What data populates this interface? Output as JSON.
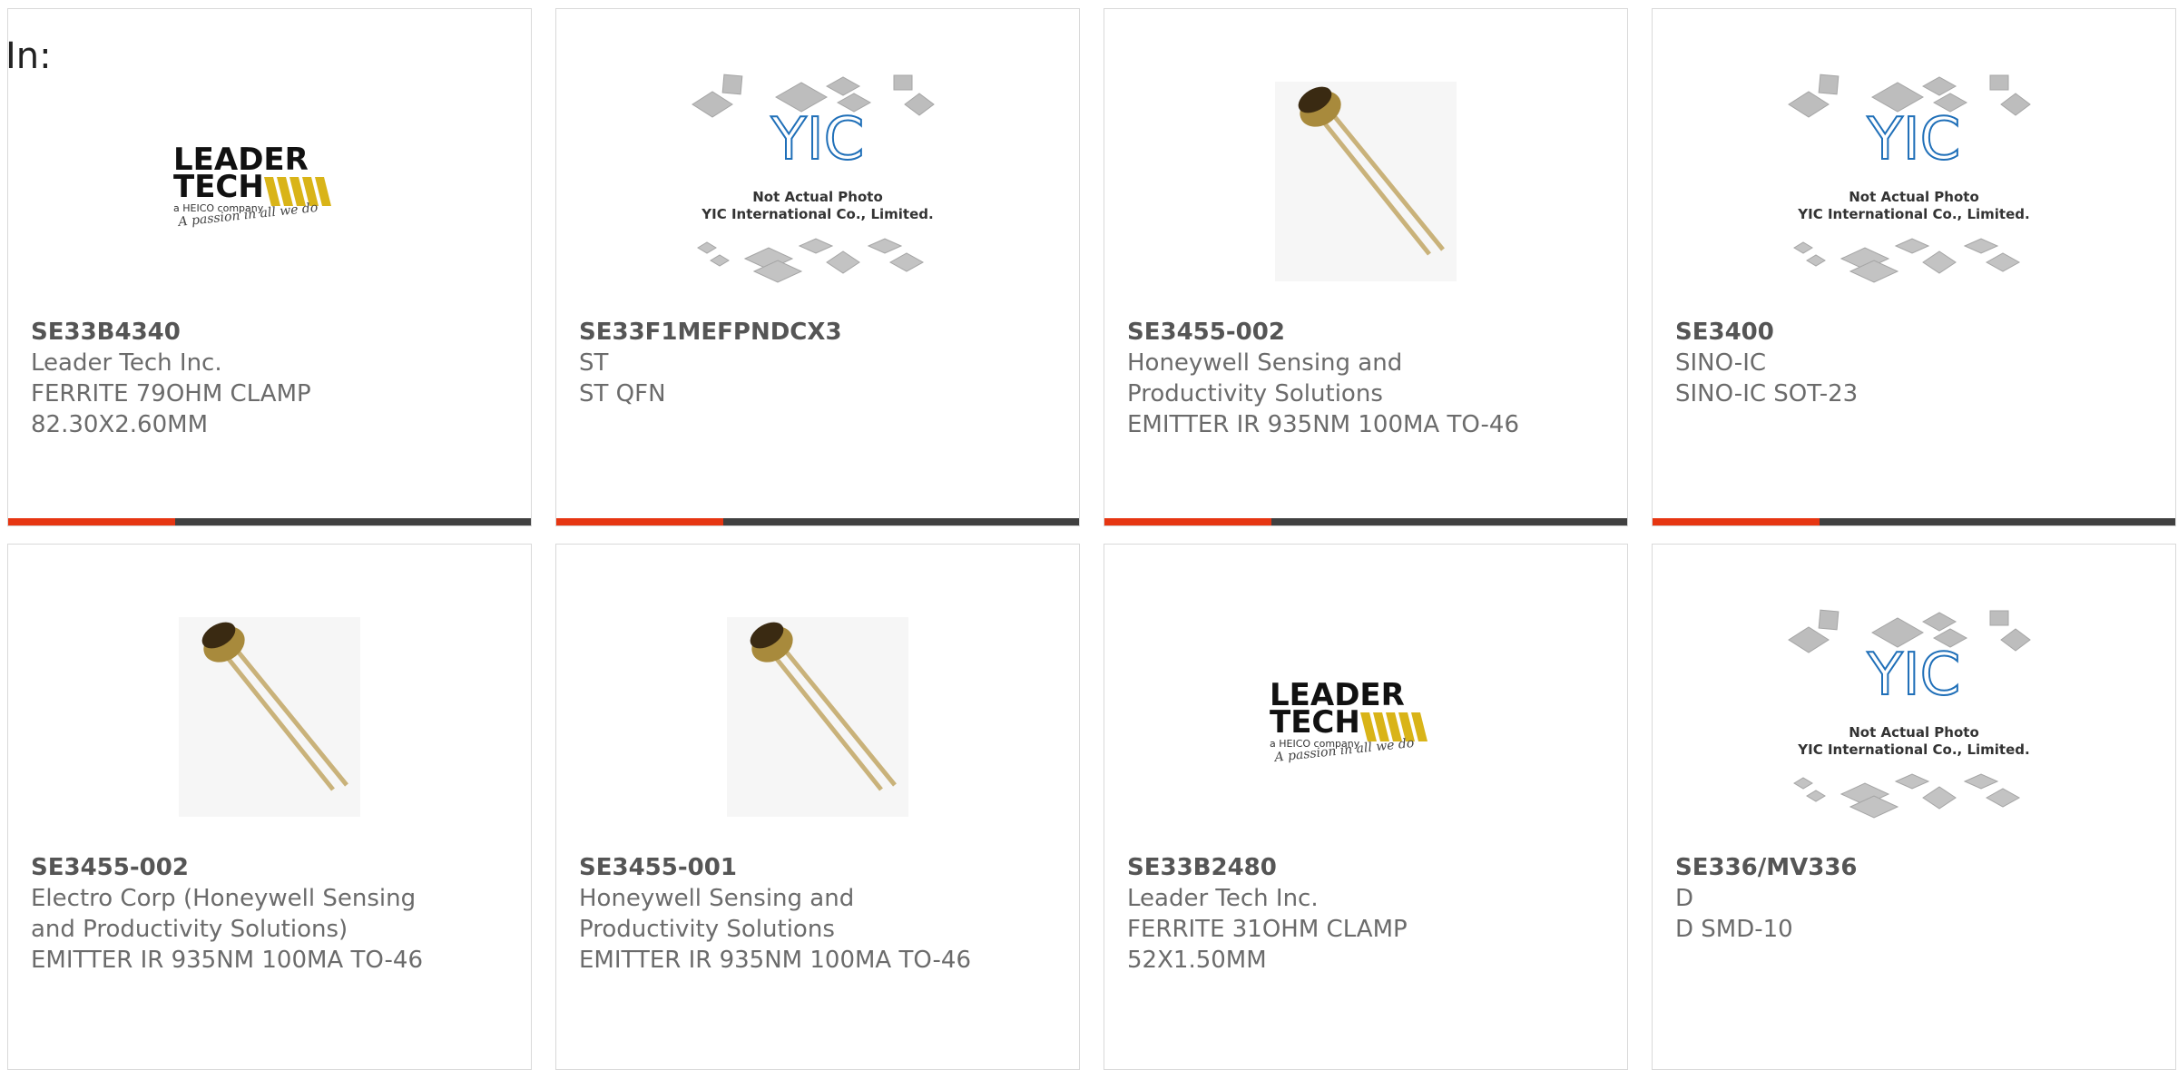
{
  "header": {
    "label": "In:"
  },
  "colors": {
    "accent": "#e63612",
    "bar": "#404040",
    "text": "#6b6b6b",
    "border": "#d9d9d9"
  },
  "placeholder": {
    "line1": "Not Actual Photo",
    "line2": "YIC International Co., Limited.",
    "logo": "YIC"
  },
  "leadertech_logo": {
    "line1": "LEADER",
    "line2": "TECH",
    "sub": "a HEICO company",
    "slogan": "A passion in all we do"
  },
  "cards": [
    {
      "part": "SE33B4340",
      "manufacturer": "Leader Tech Inc.",
      "desc": "FERRITE 79OHM CLAMP",
      "desc2": "82.30X2.60MM",
      "image": "leadertech-logo"
    },
    {
      "part": "SE33F1MEFPNDCX3",
      "manufacturer": "ST",
      "desc": "ST QFN",
      "image": "placeholder"
    },
    {
      "part": "SE3455-002",
      "manufacturer": "Honeywell Sensing and",
      "manufacturer2": "Productivity Solutions",
      "desc": "EMITTER IR 935NM 100MA TO-46",
      "image": "to46-emitter"
    },
    {
      "part": "SE3400",
      "manufacturer": "SINO-IC",
      "desc": "SINO-IC SOT-23",
      "image": "placeholder"
    },
    {
      "part": "SE3455-002",
      "manufacturer": "Electro Corp (Honeywell Sensing",
      "manufacturer2": "and Productivity Solutions)",
      "desc": "EMITTER IR 935NM 100MA TO-46",
      "image": "to46-emitter"
    },
    {
      "part": "SE3455-001",
      "manufacturer": "Honeywell Sensing and",
      "manufacturer2": "Productivity Solutions",
      "desc": "EMITTER IR 935NM 100MA TO-46",
      "image": "to46-emitter"
    },
    {
      "part": "SE33B2480",
      "manufacturer": "Leader Tech Inc.",
      "desc": "FERRITE 31OHM CLAMP",
      "desc2": "52X1.50MM",
      "image": "leadertech-logo"
    },
    {
      "part": "SE336/MV336",
      "manufacturer": "D",
      "desc": "D SMD-10",
      "image": "placeholder"
    }
  ]
}
